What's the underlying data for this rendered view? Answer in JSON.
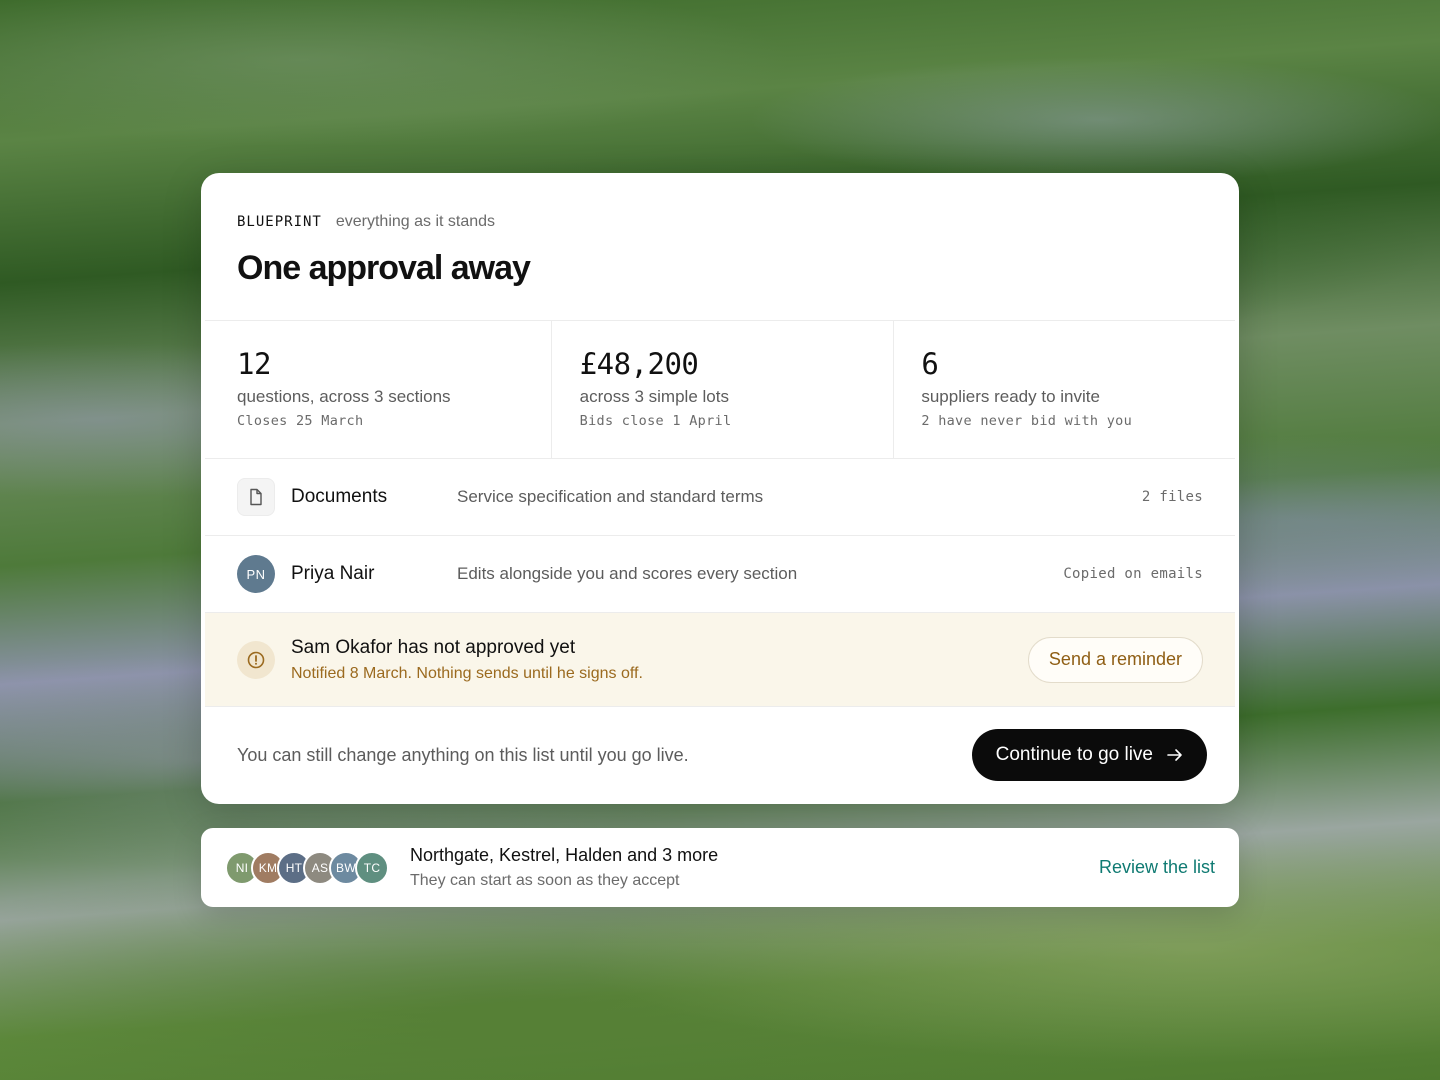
{
  "header": {
    "eyebrow_tag": "BLUEPRINT",
    "eyebrow_sub": "everything as it stands",
    "title": "One approval away"
  },
  "stats": [
    {
      "value": "12",
      "label": "questions, across 3 sections",
      "sub": "Closes 25 March"
    },
    {
      "value": "£48,200",
      "label": "across 3 simple lots",
      "sub": "Bids close 1 April"
    },
    {
      "value": "6",
      "label": "suppliers ready to invite",
      "sub": "2 have never bid with you"
    }
  ],
  "documents": {
    "icon": "document-icon",
    "title": "Documents",
    "desc": "Service specification and standard terms",
    "meta": "2 files"
  },
  "collaborator": {
    "initials": "PN",
    "name": "Priya Nair",
    "desc": "Edits alongside you and scores every section",
    "meta": "Copied on emails"
  },
  "alert": {
    "icon": "alert-circle-icon",
    "title": "Sam Okafor has not approved yet",
    "sub": "Notified 8 March. Nothing sends until he signs off.",
    "button": "Send a reminder"
  },
  "footer": {
    "note": "You can still change anything on this list until you go live.",
    "primary_button": "Continue to go live",
    "primary_icon": "arrow-right-icon"
  },
  "suppliers": {
    "avatars": [
      {
        "initials": "NI",
        "color": "#7f9a6e"
      },
      {
        "initials": "KM",
        "color": "#a07c62"
      },
      {
        "initials": "HT",
        "color": "#5c6e86"
      },
      {
        "initials": "AS",
        "color": "#8e8a80"
      },
      {
        "initials": "BW",
        "color": "#6d8aa0"
      },
      {
        "initials": "TC",
        "color": "#5f8f80"
      }
    ],
    "title": "Northgate, Kestrel, Halden and 3 more",
    "sub": "They can start as soon as they accept",
    "link": "Review the list"
  },
  "colors": {
    "accent_link": "#0f7a72",
    "warning_text": "#9b6a1f",
    "warning_bg": "#faf6ea",
    "primary_button": "#0b0b0b"
  }
}
